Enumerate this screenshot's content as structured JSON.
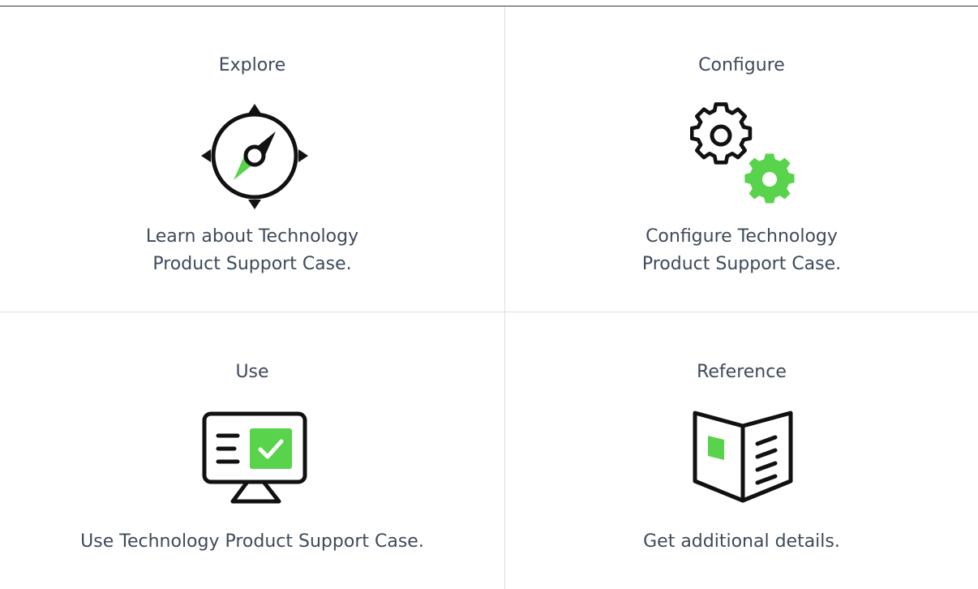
{
  "cards": [
    {
      "title": "Explore",
      "icon": "compass-icon",
      "description": "Learn about Technology\nProduct Support Case."
    },
    {
      "title": "Configure",
      "icon": "gears-icon",
      "description": "Configure Technology\nProduct Support Case."
    },
    {
      "title": "Use",
      "icon": "monitor-check-icon",
      "description": "Use Technology Product Support Case."
    },
    {
      "title": "Reference",
      "icon": "open-book-icon",
      "description": "Get additional details."
    }
  ],
  "colors": {
    "accent": "#5ad34c",
    "text": "#3e4a59",
    "icon_stroke": "#111111",
    "divider": "#dcdfe3"
  }
}
